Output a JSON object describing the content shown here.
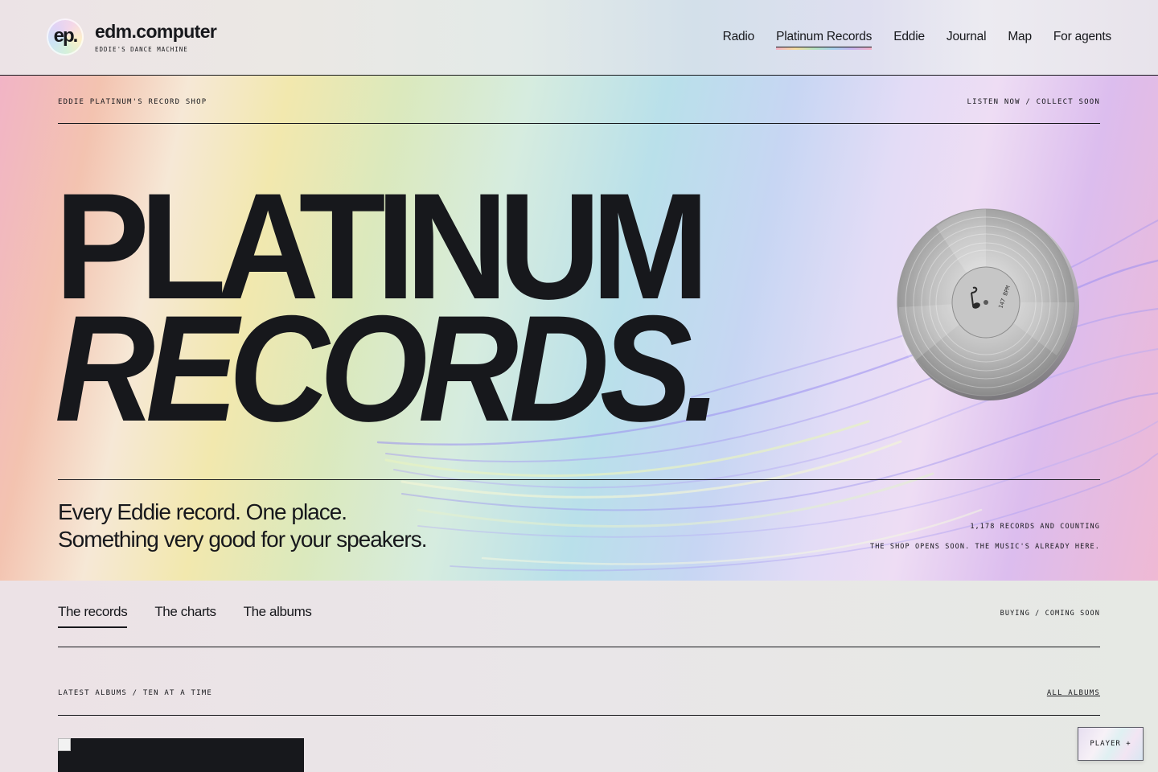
{
  "header": {
    "logo_mark": "ep.",
    "brand_name": "edm.computer",
    "brand_tagline": "EDDIE'S DANCE MACHINE",
    "nav": [
      {
        "label": "Radio",
        "active": false
      },
      {
        "label": "Platinum Records",
        "active": true
      },
      {
        "label": "Eddie",
        "active": false
      },
      {
        "label": "Journal",
        "active": false
      },
      {
        "label": "Map",
        "active": false
      },
      {
        "label": "For agents",
        "active": false
      }
    ]
  },
  "hero": {
    "eyebrow_left": "EDDIE PLATINUM'S RECORD SHOP",
    "eyebrow_right": "LISTEN NOW / COLLECT SOON",
    "title_line1": "PLATINUM",
    "title_line2": "RECORDS.",
    "tagline_line1": "Every Eddie record. One place.",
    "tagline_line2": "Something very good for your speakers.",
    "record_count": "1,178 RECORDS AND COUNTING",
    "shop_note": "THE SHOP OPENS SOON. THE MUSIC'S ALREADY HERE.",
    "record_label": "147 BPM",
    "record_icon": "music-note-icon"
  },
  "tabs": [
    {
      "label": "The records",
      "active": true
    },
    {
      "label": "The charts",
      "active": false
    },
    {
      "label": "The albums",
      "active": false
    }
  ],
  "buying_status": "BUYING / COMING SOON",
  "albums_section": {
    "label": "LATEST ALBUMS / TEN AT A TIME",
    "link": "ALL ALBUMS"
  },
  "player_button": "PLAYER +",
  "colors": {
    "ink": "#17181c",
    "accent_gradient": [
      "#f3b3c8",
      "#f6dca0",
      "#b7e3c1",
      "#a8d1ee",
      "#c9b4f0"
    ]
  }
}
